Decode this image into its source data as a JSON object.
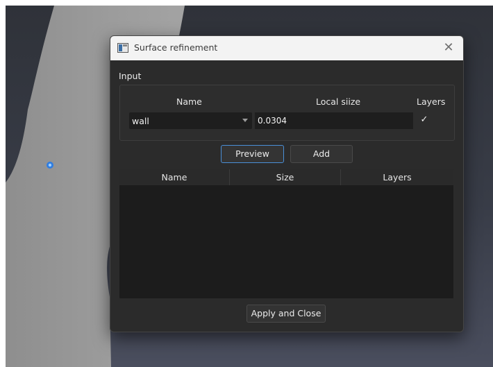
{
  "dialog": {
    "title": "Surface refinement",
    "close_glyph": "✕",
    "app_icon": "window-icon"
  },
  "input_group": {
    "label": "Input",
    "headers": {
      "name": "Name",
      "local_size": "Local siize",
      "layers": "Layers"
    },
    "name_value": "wall",
    "local_size_value": "0.0304",
    "layers_checked": true,
    "check_glyph": "✓"
  },
  "buttons": {
    "preview": "Preview",
    "add": "Add",
    "apply_close": "Apply and Close"
  },
  "table": {
    "columns": [
      "Name",
      "Size",
      "Layers"
    ],
    "rows": []
  },
  "colors": {
    "accent": "#4a90d9",
    "marker": "#2f7de1"
  }
}
